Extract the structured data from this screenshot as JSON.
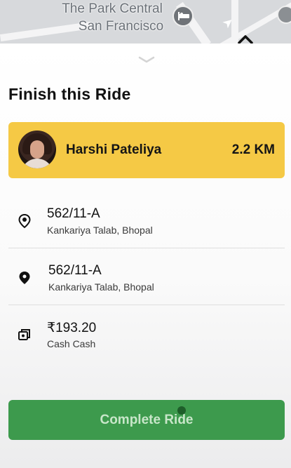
{
  "map": {
    "labels": [
      "The Park Central",
      "San Francisco"
    ],
    "icons": [
      "hotel-pin-icon",
      "museum-pin-icon",
      "direction-arrow-icon",
      "collapse-caret-icon"
    ]
  },
  "sheet": {
    "title": "Finish this Ride",
    "handle_icon": "chevron-down-icon"
  },
  "rider": {
    "name": "Harshi Pateliya",
    "distance": "2.2 KM",
    "card_color": "#f5c945"
  },
  "trip": {
    "pickup": {
      "line1": "562/11-A",
      "line2": "Kankariya Talab, Bhopal",
      "icon": "pickup-location-icon"
    },
    "dropoff": {
      "line1": "562/11-A",
      "line2": "Kankariya Talab, Bhopal",
      "icon": "dropoff-location-icon"
    },
    "payment": {
      "amount": "₹193.20",
      "method": "Cash Cash",
      "icon": "cash-icon"
    }
  },
  "actions": {
    "complete_label": "Complete Ride",
    "button_color": "#3d9a4d"
  }
}
